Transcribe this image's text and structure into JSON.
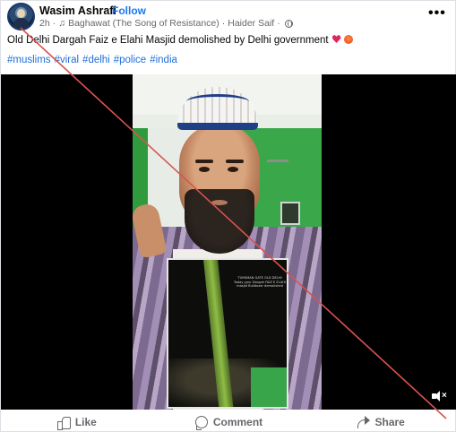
{
  "post": {
    "author": "Wasim Ashrafi",
    "follow_separator": "·",
    "follow_label": "Follow",
    "time": "2h",
    "audio_track": "Baghawat (The Song of Resistance)",
    "audio_separator": "·",
    "audio_artist": "Haider Saif",
    "audio_after_sep": "·",
    "caption": "Old Delhi Dargah Faiz e Elahi Masjid demolished by Delhi government",
    "hashtags": [
      "#muslims",
      "#viral",
      "#delhi",
      "#police",
      "#india"
    ],
    "more_label": "•••"
  },
  "video": {
    "inset_text": "TURKMAN GATE OLD DELHI Today ypur Dargah FAIZ E ELAHI masjid Bulldozer demolished",
    "muted": true
  },
  "actions": {
    "like": "Like",
    "comment": "Comment",
    "share": "Share"
  },
  "colors": {
    "link": "#1877f2",
    "hashtag": "#216fdb",
    "strike_line": "#d9534f",
    "secondary_text": "#65676b"
  },
  "icons": {
    "audio": "music-note-icon",
    "privacy": "globe-icon",
    "more": "more-options-icon",
    "like": "thumbs-up-icon",
    "comment": "speech-bubble-icon",
    "share": "share-arrow-icon",
    "mute": "speaker-muted-icon"
  }
}
